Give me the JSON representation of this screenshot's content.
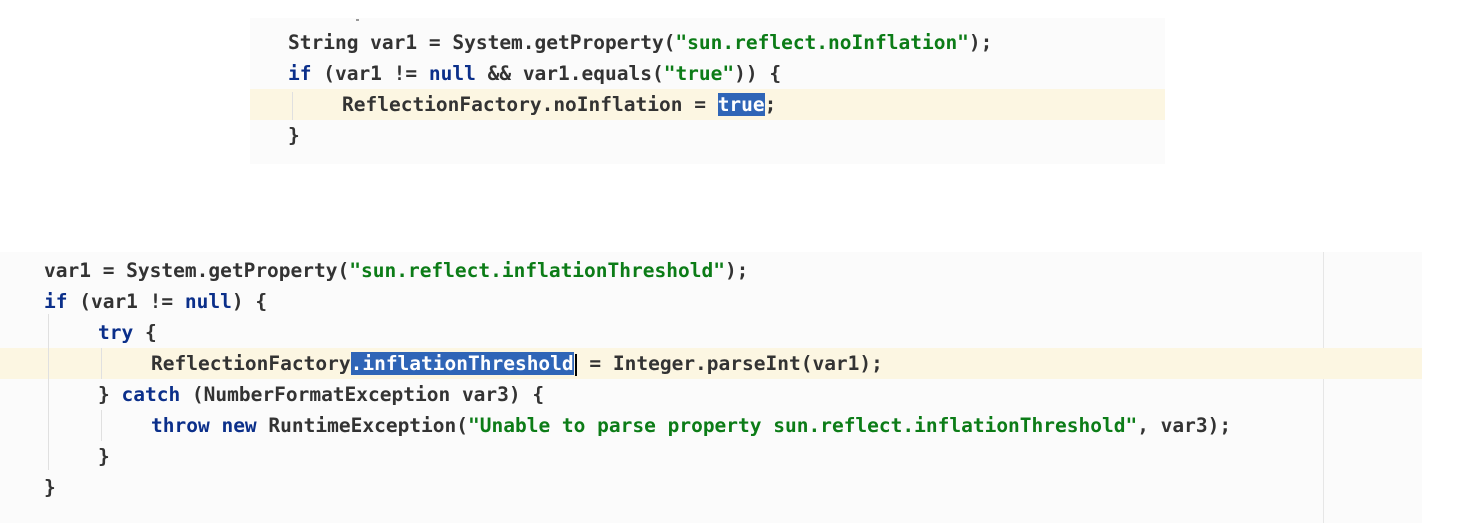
{
  "snippet_top": {
    "lines": [
      {
        "p1": "String var1 = System.getProperty(",
        "str": "\"sun.reflect.noInflation\"",
        "p2": ");"
      },
      {
        "kw1": "if",
        "p1": " (var1 != ",
        "kw2": "null",
        "p2": " && var1.equals(",
        "str": "\"true\"",
        "p3": ")) {"
      },
      {
        "p1": "ReflectionFactory.noInflation = ",
        "sel": "true",
        "p2": ";"
      },
      {
        "p1": "}"
      }
    ]
  },
  "snippet_bottom": {
    "lines": [
      {
        "p1": "var1 = System.getProperty(",
        "str": "\"sun.reflect.inflationThreshold\"",
        "p2": ");"
      },
      {
        "kw1": "if",
        "p1": " (var1 != ",
        "kw2": "null",
        "p2": ") {"
      },
      {
        "kw1": "try",
        "p1": " {"
      },
      {
        "p1": "ReflectionFactory",
        "sel": ".inflationThreshold",
        "p2": " = Integer.parseInt(var1);"
      },
      {
        "p1": "} ",
        "kw1": "catch",
        "p2": " (NumberFormatException var3) {"
      },
      {
        "kw1": "throw",
        "kw2": "new",
        "p1": " RuntimeException(",
        "str": "\"Unable to parse property sun.reflect.inflationThreshold\"",
        "p2": ", var3);"
      },
      {
        "p1": "}"
      },
      {
        "p1": "}"
      }
    ]
  },
  "colors": {
    "keyword": "#0b2f8a",
    "string": "#0c7c17",
    "selection": "#2f65b7",
    "current_line": "#fcf6e2",
    "text": "#333333"
  }
}
